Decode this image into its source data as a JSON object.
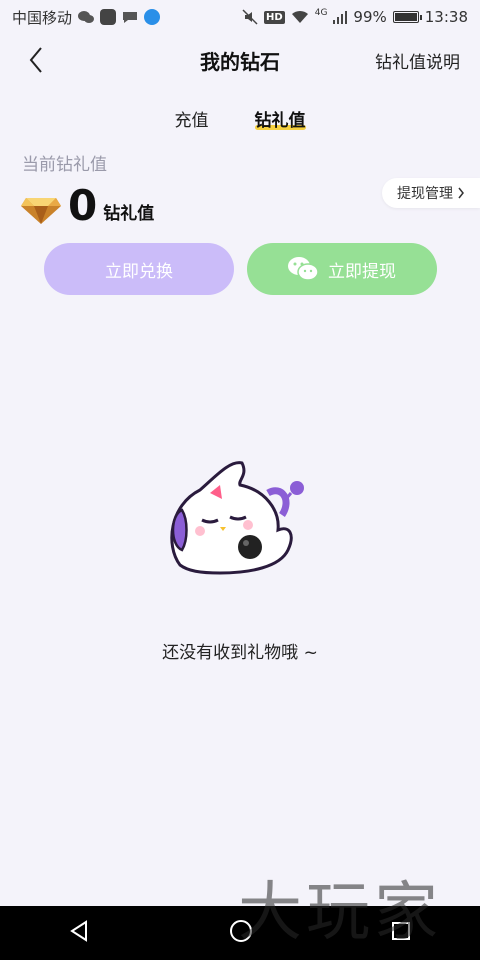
{
  "status_bar": {
    "carrier": "中国移动",
    "net": "4G",
    "hd": "HD",
    "battery_pct": "99%",
    "battery_fill": 0.99,
    "time": "13:38",
    "icons": [
      "wechat-icon",
      "app-icon",
      "message-icon",
      "browser-icon",
      "mute-icon",
      "wifi-icon",
      "signal-icon"
    ]
  },
  "navbar": {
    "title": "我的钻石",
    "right_link": "钻礼值说明"
  },
  "tabs": [
    {
      "label": "充值",
      "active": false
    },
    {
      "label": "钻礼值",
      "active": true
    }
  ],
  "balance": {
    "label": "当前钻礼值",
    "value": "0",
    "unit": "钻礼值",
    "manage_label": "提现管理"
  },
  "actions": {
    "exchange_label": "立即兑换",
    "withdraw_label": "立即提现"
  },
  "empty_state": {
    "message": "还没有收到礼物哦 ~"
  },
  "watermark": "大玩家",
  "colors": {
    "background": "#f4f3fa",
    "exchange_btn": "#cbbcf9",
    "withdraw_btn": "#96e095",
    "tab_underline": "#f6d13f"
  }
}
